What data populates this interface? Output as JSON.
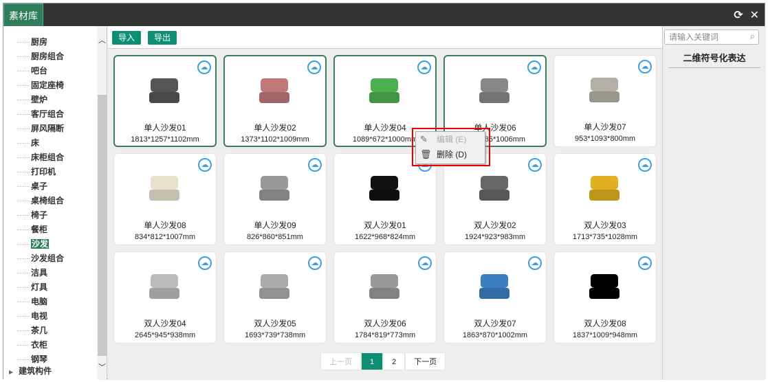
{
  "title": "素材库",
  "toolbar": {
    "import": "导入",
    "export": "导出",
    "search_placeholder": "请输入关键词"
  },
  "right_panel": {
    "title": "二维符号化表达"
  },
  "sidebar": {
    "items": [
      "厨房",
      "厨房组合",
      "吧台",
      "固定座椅",
      "壁炉",
      "客厅组合",
      "屏风隔断",
      "床",
      "床柜组合",
      "打印机",
      "桌子",
      "桌椅组合",
      "椅子",
      "餐柜",
      "沙发",
      "沙发组合",
      "洁具",
      "灯具",
      "电脑",
      "电视",
      "茶几",
      "衣柜",
      "钢琴"
    ],
    "selected": "沙发",
    "group": "建筑构件"
  },
  "cards": [
    {
      "name": "单人沙发01",
      "dims": "1813*1257*1102mm",
      "color": "#555555"
    },
    {
      "name": "单人沙发02",
      "dims": "1373*1102*1009mm",
      "color": "#c07878"
    },
    {
      "name": "单人沙发04",
      "dims": "1089*672*1000mm",
      "color": "#4caf50"
    },
    {
      "name": "单人沙发06",
      "dims": "985*985*1006mm",
      "color": "#888888"
    },
    {
      "name": "单人沙发07",
      "dims": "953*1093*800mm",
      "color": "#b5b0a5"
    },
    {
      "name": "单人沙发08",
      "dims": "834*812*1007mm",
      "color": "#e8e2cc"
    },
    {
      "name": "单人沙发09",
      "dims": "826*860*851mm",
      "color": "#999999"
    },
    {
      "name": "双人沙发01",
      "dims": "1622*968*824mm",
      "color": "#111111"
    },
    {
      "name": "双人沙发02",
      "dims": "1924*923*983mm",
      "color": "#666666"
    },
    {
      "name": "双人沙发03",
      "dims": "1713*735*1028mm",
      "color": "#e0b020"
    },
    {
      "name": "双人沙发04",
      "dims": "2645*945*938mm",
      "color": "#bbbbbb"
    },
    {
      "name": "双人沙发05",
      "dims": "1693*739*738mm",
      "color": "#aaaaaa"
    },
    {
      "name": "双人沙发06",
      "dims": "1784*819*773mm",
      "color": "#999999"
    },
    {
      "name": "双人沙发07",
      "dims": "1863*870*1002mm",
      "color": "#3a7fc0"
    },
    {
      "name": "双人沙发08",
      "dims": "1837*1009*948mm",
      "color": "#000000"
    }
  ],
  "pagination": {
    "prev": "上一页",
    "pages": [
      "1",
      "2"
    ],
    "current": "1",
    "next": "下一页"
  },
  "context_menu": {
    "edit": "编辑 (E)",
    "delete": "删除 (D)"
  }
}
